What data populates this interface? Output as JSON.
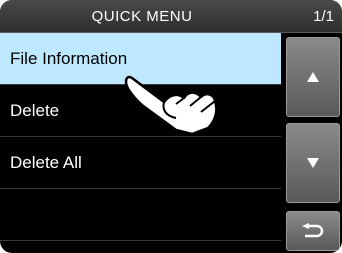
{
  "window": {
    "title": "QUICK MENU",
    "page_indicator": "1/1"
  },
  "menu": {
    "items": [
      {
        "label": "File Information",
        "selected": true
      },
      {
        "label": "Delete",
        "selected": false
      },
      {
        "label": "Delete All",
        "selected": false
      },
      {
        "label": "",
        "selected": false
      }
    ]
  },
  "scroll": {
    "up_icon": "triangle-up-icon",
    "down_icon": "triangle-down-icon",
    "back_icon": "return-arrow-icon"
  },
  "overlay": {
    "icon": "tap-hand-icon"
  },
  "colors": {
    "selected_bg": "#bde8ff",
    "background": "#000000",
    "button_gradient_top": "#8a8a8a",
    "button_gradient_bottom": "#595959"
  }
}
